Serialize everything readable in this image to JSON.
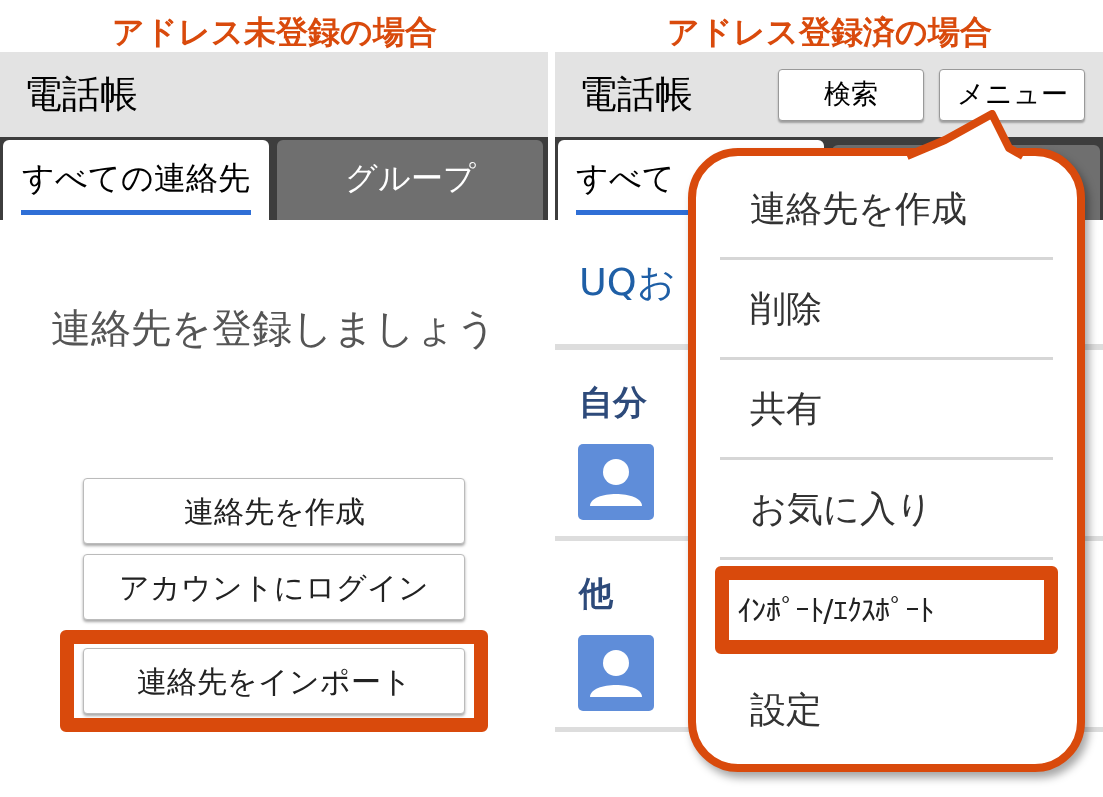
{
  "unregistered": {
    "caption": "アドレス未登録の場合",
    "title": "電話帳",
    "tabs": [
      {
        "label": "すべての連絡先",
        "selected": true
      },
      {
        "label": "グループ",
        "selected": false
      }
    ],
    "empty_message": "連絡先を登録しましょう",
    "buttons": [
      {
        "label": "連絡先を作成",
        "highlighted": false
      },
      {
        "label": "アカウントにログイン",
        "highlighted": false
      },
      {
        "label": "連絡先をインポート",
        "highlighted": true
      }
    ]
  },
  "registered": {
    "caption": "アドレス登録済の場合",
    "title": "電話帳",
    "toolbar_buttons": [
      "検索",
      "メニュー"
    ],
    "tabs": [
      {
        "label": "すべて",
        "selected": true
      }
    ],
    "list": [
      {
        "kind": "row",
        "label": "UQお"
      },
      {
        "kind": "header",
        "label": "自分"
      },
      {
        "kind": "avatar"
      },
      {
        "kind": "header",
        "label": "他"
      },
      {
        "kind": "avatar"
      }
    ],
    "menu": [
      {
        "label": "連絡先を作成",
        "highlighted": false
      },
      {
        "label": "削除",
        "highlighted": false
      },
      {
        "label": "共有",
        "highlighted": false
      },
      {
        "label": "お気に入り",
        "highlighted": false
      },
      {
        "label": "ｲﾝﾎﾟｰﾄ/ｴｸｽﾎﾟｰﾄ",
        "highlighted": true
      },
      {
        "label": "設定",
        "highlighted": false
      }
    ]
  }
}
